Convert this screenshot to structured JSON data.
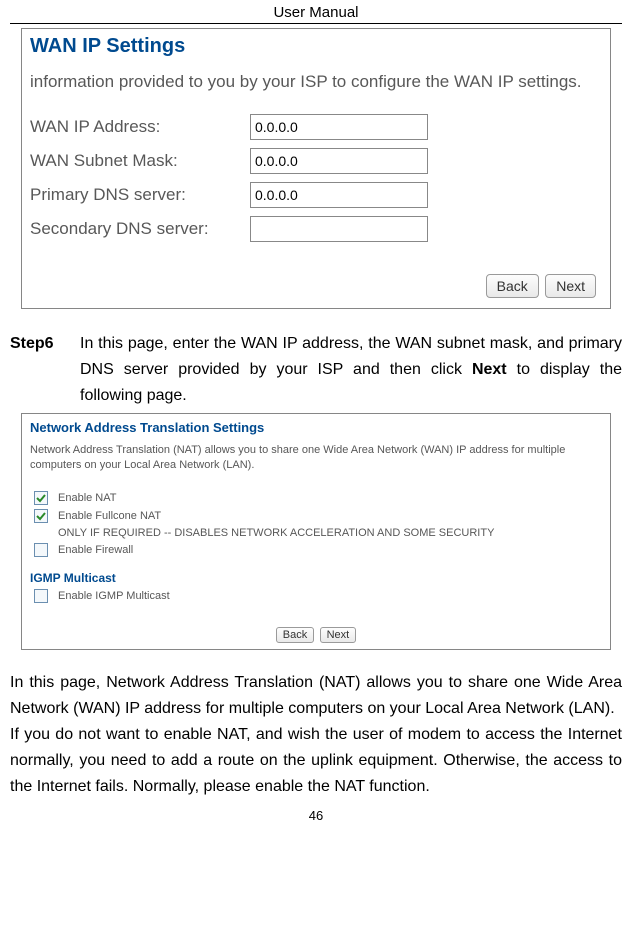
{
  "header": {
    "title": "User Manual"
  },
  "screenshot1": {
    "title": "WAN IP Settings",
    "info": "information provided to you by your ISP to configure the WAN IP settings.",
    "rows": [
      {
        "label": "WAN IP Address:",
        "value": "0.0.0.0"
      },
      {
        "label": "WAN Subnet Mask:",
        "value": "0.0.0.0"
      },
      {
        "label": "Primary DNS server:",
        "value": "0.0.0.0"
      },
      {
        "label": "Secondary DNS server:",
        "value": ""
      }
    ],
    "back": "Back",
    "next": "Next"
  },
  "step6": {
    "label": "Step6",
    "text_before": "In this page, enter the WAN IP address, the WAN subnet mask, and primary DNS server provided by your ISP and then click ",
    "bold": "Next",
    "text_after": " to display the following page."
  },
  "screenshot2": {
    "title": "Network Address Translation Settings",
    "desc": "Network Address Translation (NAT) allows you to share one Wide Area Network (WAN) IP address for multiple computers on your Local Area Network (LAN).",
    "cb1": "Enable NAT",
    "cb2": "Enable Fullcone NAT",
    "note": "ONLY IF REQUIRED -- DISABLES NETWORK ACCELERATION AND SOME SECURITY",
    "cb3": "Enable Firewall",
    "subtitle": "IGMP Multicast",
    "cb4": "Enable IGMP Multicast",
    "back": "Back",
    "next": "Next"
  },
  "para1": "In this page, Network Address Translation (NAT) allows you to share one Wide Area Network (WAN) IP address for multiple computers on your Local Area Network (LAN).",
  "para2": "If you do not want to enable NAT, and wish the user of modem to access the Internet normally, you need to add a route on the uplink equipment. Otherwise, the access to the Internet fails. Normally, please enable the NAT function.",
  "page_number": "46"
}
